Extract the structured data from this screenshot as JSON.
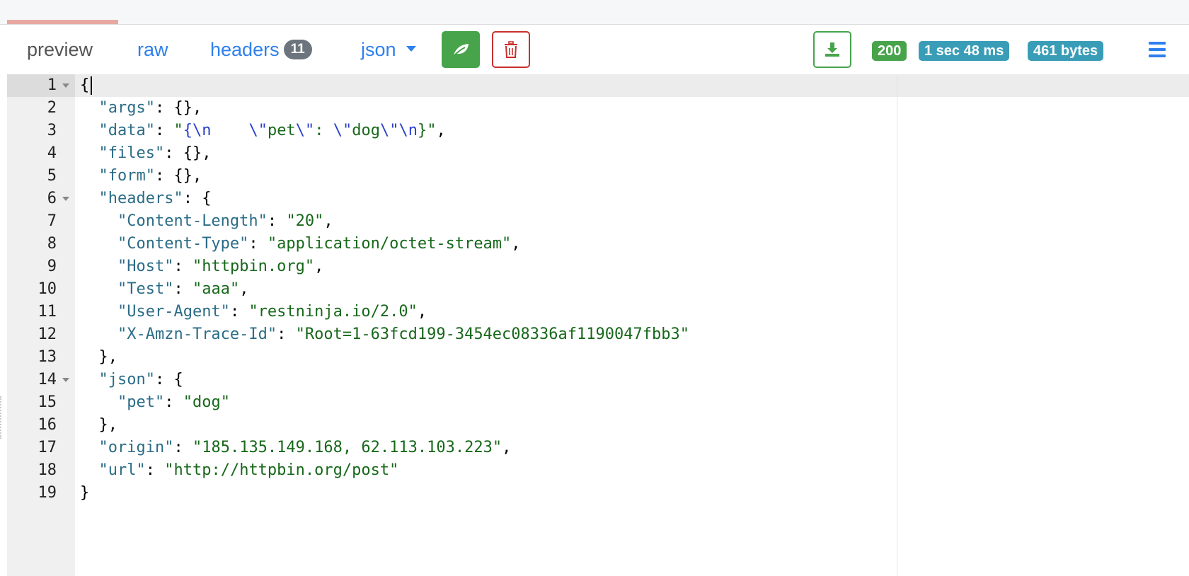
{
  "tabs": {
    "preview": "preview",
    "raw": "raw",
    "headers": "headers",
    "headers_count": "11",
    "format": "json"
  },
  "toolbar": {
    "beautify_icon": "leaf-icon",
    "clear_icon": "trash-icon",
    "download_icon": "download-icon",
    "menu_icon": "hamburger-icon"
  },
  "status": {
    "code": "200",
    "time": "1 sec 48 ms",
    "size": "461 bytes"
  },
  "colors": {
    "success": "#47a44b",
    "info": "#3a9db7",
    "danger": "#c9302c",
    "link": "#2f80ed",
    "json_key": "#2b6c87",
    "json_string": "#17681a",
    "json_escape": "#2a41c9"
  },
  "editor": {
    "lines": [
      {
        "n": "1",
        "fold": true,
        "parts": [
          [
            "p",
            "{"
          ]
        ]
      },
      {
        "n": "2",
        "fold": false,
        "parts": [
          [
            "p",
            "  "
          ],
          [
            "k",
            "\"args\""
          ],
          [
            "p",
            ": {},"
          ]
        ]
      },
      {
        "n": "3",
        "fold": false,
        "parts": [
          [
            "p",
            "  "
          ],
          [
            "k",
            "\"data\""
          ],
          [
            "p",
            ": "
          ],
          [
            "s",
            "\""
          ],
          [
            "e",
            "{\\n"
          ],
          [
            "s",
            "    "
          ],
          [
            "e",
            "\\\""
          ],
          [
            "s",
            "pet"
          ],
          [
            "e",
            "\\\""
          ],
          [
            "s",
            ": "
          ],
          [
            "e",
            "\\\""
          ],
          [
            "s",
            "dog"
          ],
          [
            "e",
            "\\\"\\n"
          ],
          [
            "s",
            "}\""
          ],
          [
            "p",
            ","
          ]
        ]
      },
      {
        "n": "4",
        "fold": false,
        "parts": [
          [
            "p",
            "  "
          ],
          [
            "k",
            "\"files\""
          ],
          [
            "p",
            ": {},"
          ]
        ]
      },
      {
        "n": "5",
        "fold": false,
        "parts": [
          [
            "p",
            "  "
          ],
          [
            "k",
            "\"form\""
          ],
          [
            "p",
            ": {},"
          ]
        ]
      },
      {
        "n": "6",
        "fold": true,
        "parts": [
          [
            "p",
            "  "
          ],
          [
            "k",
            "\"headers\""
          ],
          [
            "p",
            ": {"
          ]
        ]
      },
      {
        "n": "7",
        "fold": false,
        "parts": [
          [
            "p",
            "    "
          ],
          [
            "k",
            "\"Content-Length\""
          ],
          [
            "p",
            ": "
          ],
          [
            "s",
            "\"20\""
          ],
          [
            "p",
            ","
          ]
        ]
      },
      {
        "n": "8",
        "fold": false,
        "parts": [
          [
            "p",
            "    "
          ],
          [
            "k",
            "\"Content-Type\""
          ],
          [
            "p",
            ": "
          ],
          [
            "s",
            "\"application/octet-stream\""
          ],
          [
            "p",
            ","
          ]
        ]
      },
      {
        "n": "9",
        "fold": false,
        "parts": [
          [
            "p",
            "    "
          ],
          [
            "k",
            "\"Host\""
          ],
          [
            "p",
            ": "
          ],
          [
            "s",
            "\"httpbin.org\""
          ],
          [
            "p",
            ","
          ]
        ]
      },
      {
        "n": "10",
        "fold": false,
        "parts": [
          [
            "p",
            "    "
          ],
          [
            "k",
            "\"Test\""
          ],
          [
            "p",
            ": "
          ],
          [
            "s",
            "\"aaa\""
          ],
          [
            "p",
            ","
          ]
        ]
      },
      {
        "n": "11",
        "fold": false,
        "parts": [
          [
            "p",
            "    "
          ],
          [
            "k",
            "\"User-Agent\""
          ],
          [
            "p",
            ": "
          ],
          [
            "s",
            "\"restninja.io/2.0\""
          ],
          [
            "p",
            ","
          ]
        ]
      },
      {
        "n": "12",
        "fold": false,
        "parts": [
          [
            "p",
            "    "
          ],
          [
            "k",
            "\"X-Amzn-Trace-Id\""
          ],
          [
            "p",
            ": "
          ],
          [
            "s",
            "\"Root=1-63fcd199-3454ec08336af1190047fbb3\""
          ]
        ]
      },
      {
        "n": "13",
        "fold": false,
        "parts": [
          [
            "p",
            "  },"
          ]
        ]
      },
      {
        "n": "14",
        "fold": true,
        "parts": [
          [
            "p",
            "  "
          ],
          [
            "k",
            "\"json\""
          ],
          [
            "p",
            ": {"
          ]
        ]
      },
      {
        "n": "15",
        "fold": false,
        "parts": [
          [
            "p",
            "    "
          ],
          [
            "k",
            "\"pet\""
          ],
          [
            "p",
            ": "
          ],
          [
            "s",
            "\"dog\""
          ]
        ]
      },
      {
        "n": "16",
        "fold": false,
        "parts": [
          [
            "p",
            "  },"
          ]
        ]
      },
      {
        "n": "17",
        "fold": false,
        "parts": [
          [
            "p",
            "  "
          ],
          [
            "k",
            "\"origin\""
          ],
          [
            "p",
            ": "
          ],
          [
            "s",
            "\"185.135.149.168, 62.113.103.223\""
          ],
          [
            "p",
            ","
          ]
        ]
      },
      {
        "n": "18",
        "fold": false,
        "parts": [
          [
            "p",
            "  "
          ],
          [
            "k",
            "\"url\""
          ],
          [
            "p",
            ": "
          ],
          [
            "s",
            "\"http://httpbin.org/post\""
          ]
        ]
      },
      {
        "n": "19",
        "fold": false,
        "parts": [
          [
            "p",
            "}"
          ]
        ]
      }
    ]
  }
}
